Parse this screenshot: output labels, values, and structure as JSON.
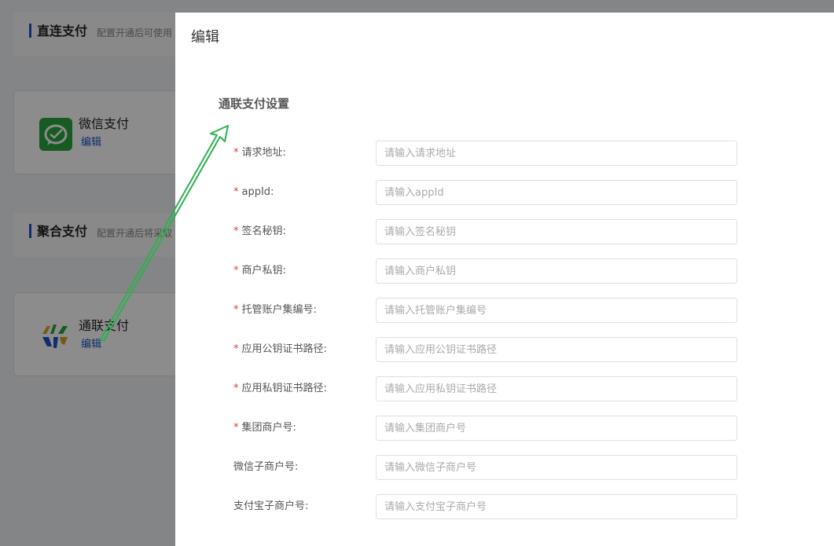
{
  "background": {
    "direct_section": {
      "title": "直连支付",
      "desc": "配置开通后可使用"
    },
    "wechat_card": {
      "name": "微信支付",
      "edit_label": "编辑",
      "icon": "wechat-pay-icon"
    },
    "aggregate_section": {
      "title": "聚合支付",
      "desc": "配置开通后将采取"
    },
    "allinpay_card": {
      "name": "通联支付",
      "edit_label": "编辑",
      "icon": "allinpay-icon"
    }
  },
  "modal": {
    "title": "编辑",
    "section_title": "通联支付设置",
    "fields": [
      {
        "label": "请求地址:",
        "required": true,
        "placeholder": "请输入请求地址",
        "value": ""
      },
      {
        "label": "appId:",
        "required": true,
        "placeholder": "请输入appId",
        "value": ""
      },
      {
        "label": "签名秘钥:",
        "required": true,
        "placeholder": "请输入签名秘钥",
        "value": ""
      },
      {
        "label": "商户私钥:",
        "required": true,
        "placeholder": "请输入商户私钥",
        "value": ""
      },
      {
        "label": "托管账户集编号:",
        "required": true,
        "placeholder": "请输入托管账户集编号",
        "value": ""
      },
      {
        "label": "应用公钥证书路径:",
        "required": true,
        "placeholder": "请输入应用公钥证书路径",
        "value": ""
      },
      {
        "label": "应用私钥证书路径:",
        "required": true,
        "placeholder": "请输入应用私钥证书路径",
        "value": ""
      },
      {
        "label": "集团商户号:",
        "required": true,
        "placeholder": "请输入集团商户号",
        "value": ""
      },
      {
        "label": "微信子商户号:",
        "required": false,
        "placeholder": "请输入微信子商户号",
        "value": ""
      },
      {
        "label": "支付宝子商户号:",
        "required": false,
        "placeholder": "请输入支付宝子商户号",
        "value": ""
      }
    ],
    "required_mark": "*"
  },
  "colors": {
    "accent": "#1a57c8",
    "required": "#e4393c",
    "annotation_arrow": "#2db14e"
  }
}
